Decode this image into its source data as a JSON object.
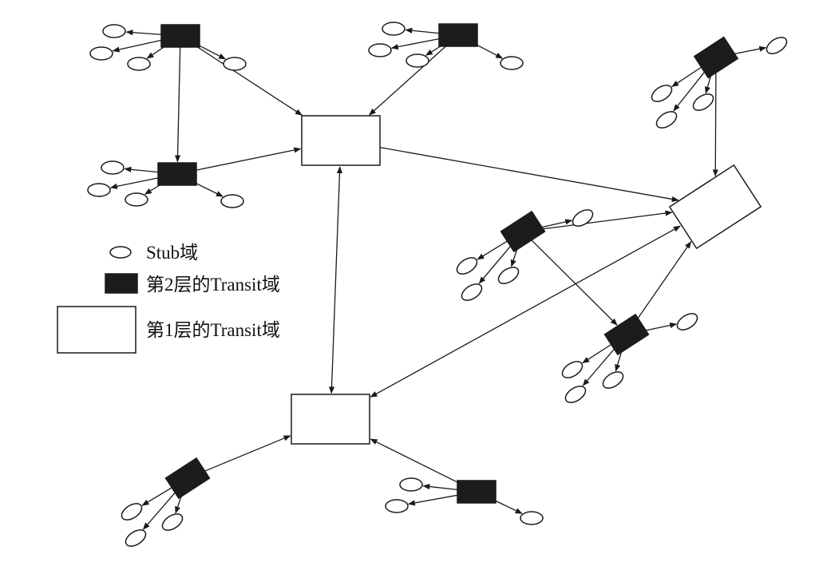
{
  "legend": {
    "stub_label": "Stub域",
    "level2_label": "第2层的Transit域",
    "level1_label": "第1层的Transit域"
  },
  "colors": {
    "stroke": "#1a1a1a",
    "level2_fill": "#1c1c1c",
    "level1_fill": "#ffffff",
    "stub_fill": "#ffffff"
  },
  "icons": {
    "stub": "stub-domain-icon",
    "level2": "level2-transit-icon",
    "level1": "level1-transit-icon"
  }
}
